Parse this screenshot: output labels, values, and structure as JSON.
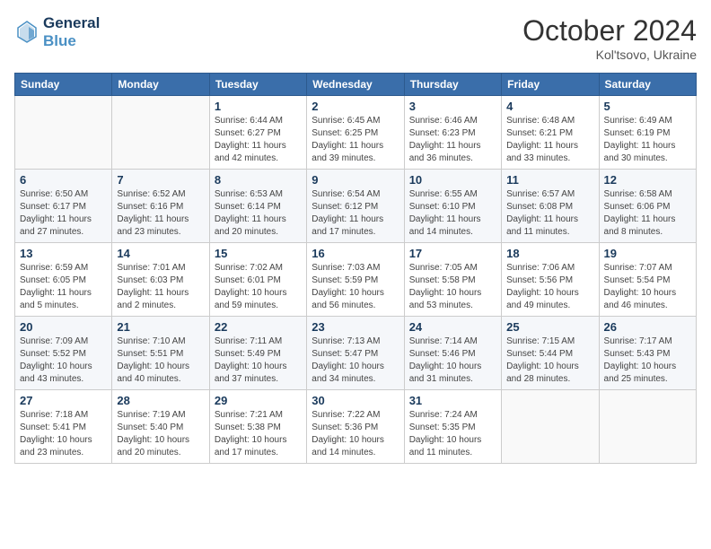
{
  "header": {
    "logo_line1": "General",
    "logo_line2": "Blue",
    "month": "October 2024",
    "location": "Kol'tsovo, Ukraine"
  },
  "weekdays": [
    "Sunday",
    "Monday",
    "Tuesday",
    "Wednesday",
    "Thursday",
    "Friday",
    "Saturday"
  ],
  "weeks": [
    [
      {
        "day": "",
        "info": ""
      },
      {
        "day": "",
        "info": ""
      },
      {
        "day": "1",
        "info": "Sunrise: 6:44 AM\nSunset: 6:27 PM\nDaylight: 11 hours and 42 minutes."
      },
      {
        "day": "2",
        "info": "Sunrise: 6:45 AM\nSunset: 6:25 PM\nDaylight: 11 hours and 39 minutes."
      },
      {
        "day": "3",
        "info": "Sunrise: 6:46 AM\nSunset: 6:23 PM\nDaylight: 11 hours and 36 minutes."
      },
      {
        "day": "4",
        "info": "Sunrise: 6:48 AM\nSunset: 6:21 PM\nDaylight: 11 hours and 33 minutes."
      },
      {
        "day": "5",
        "info": "Sunrise: 6:49 AM\nSunset: 6:19 PM\nDaylight: 11 hours and 30 minutes."
      }
    ],
    [
      {
        "day": "6",
        "info": "Sunrise: 6:50 AM\nSunset: 6:17 PM\nDaylight: 11 hours and 27 minutes."
      },
      {
        "day": "7",
        "info": "Sunrise: 6:52 AM\nSunset: 6:16 PM\nDaylight: 11 hours and 23 minutes."
      },
      {
        "day": "8",
        "info": "Sunrise: 6:53 AM\nSunset: 6:14 PM\nDaylight: 11 hours and 20 minutes."
      },
      {
        "day": "9",
        "info": "Sunrise: 6:54 AM\nSunset: 6:12 PM\nDaylight: 11 hours and 17 minutes."
      },
      {
        "day": "10",
        "info": "Sunrise: 6:55 AM\nSunset: 6:10 PM\nDaylight: 11 hours and 14 minutes."
      },
      {
        "day": "11",
        "info": "Sunrise: 6:57 AM\nSunset: 6:08 PM\nDaylight: 11 hours and 11 minutes."
      },
      {
        "day": "12",
        "info": "Sunrise: 6:58 AM\nSunset: 6:06 PM\nDaylight: 11 hours and 8 minutes."
      }
    ],
    [
      {
        "day": "13",
        "info": "Sunrise: 6:59 AM\nSunset: 6:05 PM\nDaylight: 11 hours and 5 minutes."
      },
      {
        "day": "14",
        "info": "Sunrise: 7:01 AM\nSunset: 6:03 PM\nDaylight: 11 hours and 2 minutes."
      },
      {
        "day": "15",
        "info": "Sunrise: 7:02 AM\nSunset: 6:01 PM\nDaylight: 10 hours and 59 minutes."
      },
      {
        "day": "16",
        "info": "Sunrise: 7:03 AM\nSunset: 5:59 PM\nDaylight: 10 hours and 56 minutes."
      },
      {
        "day": "17",
        "info": "Sunrise: 7:05 AM\nSunset: 5:58 PM\nDaylight: 10 hours and 53 minutes."
      },
      {
        "day": "18",
        "info": "Sunrise: 7:06 AM\nSunset: 5:56 PM\nDaylight: 10 hours and 49 minutes."
      },
      {
        "day": "19",
        "info": "Sunrise: 7:07 AM\nSunset: 5:54 PM\nDaylight: 10 hours and 46 minutes."
      }
    ],
    [
      {
        "day": "20",
        "info": "Sunrise: 7:09 AM\nSunset: 5:52 PM\nDaylight: 10 hours and 43 minutes."
      },
      {
        "day": "21",
        "info": "Sunrise: 7:10 AM\nSunset: 5:51 PM\nDaylight: 10 hours and 40 minutes."
      },
      {
        "day": "22",
        "info": "Sunrise: 7:11 AM\nSunset: 5:49 PM\nDaylight: 10 hours and 37 minutes."
      },
      {
        "day": "23",
        "info": "Sunrise: 7:13 AM\nSunset: 5:47 PM\nDaylight: 10 hours and 34 minutes."
      },
      {
        "day": "24",
        "info": "Sunrise: 7:14 AM\nSunset: 5:46 PM\nDaylight: 10 hours and 31 minutes."
      },
      {
        "day": "25",
        "info": "Sunrise: 7:15 AM\nSunset: 5:44 PM\nDaylight: 10 hours and 28 minutes."
      },
      {
        "day": "26",
        "info": "Sunrise: 7:17 AM\nSunset: 5:43 PM\nDaylight: 10 hours and 25 minutes."
      }
    ],
    [
      {
        "day": "27",
        "info": "Sunrise: 7:18 AM\nSunset: 5:41 PM\nDaylight: 10 hours and 23 minutes."
      },
      {
        "day": "28",
        "info": "Sunrise: 7:19 AM\nSunset: 5:40 PM\nDaylight: 10 hours and 20 minutes."
      },
      {
        "day": "29",
        "info": "Sunrise: 7:21 AM\nSunset: 5:38 PM\nDaylight: 10 hours and 17 minutes."
      },
      {
        "day": "30",
        "info": "Sunrise: 7:22 AM\nSunset: 5:36 PM\nDaylight: 10 hours and 14 minutes."
      },
      {
        "day": "31",
        "info": "Sunrise: 7:24 AM\nSunset: 5:35 PM\nDaylight: 10 hours and 11 minutes."
      },
      {
        "day": "",
        "info": ""
      },
      {
        "day": "",
        "info": ""
      }
    ]
  ]
}
